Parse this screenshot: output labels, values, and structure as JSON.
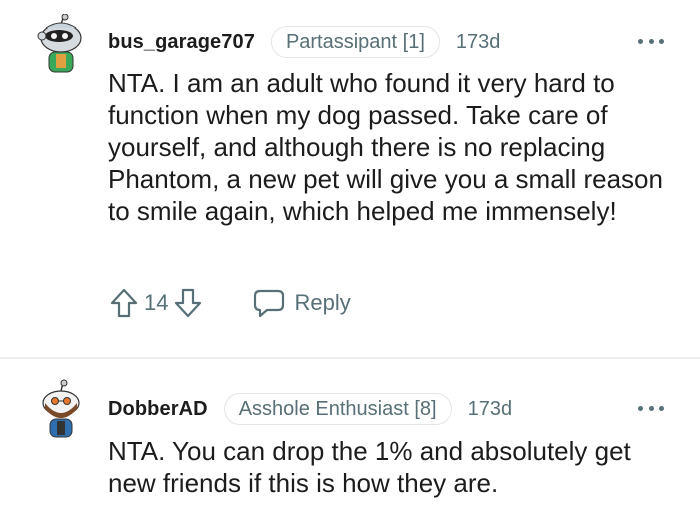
{
  "comments": [
    {
      "username": "bus_garage707",
      "flair": "Partassipant [1]",
      "age": "173d",
      "text": "NTA. I am an adult who found it very hard to function when my dog passed. Take care of yourself, and although there is no replacing Phantom, a new pet will give you a small reason to smile again, which helped me immensely!",
      "votes": "14",
      "reply_label": "Reply",
      "avatar_icon": "snoo-avatar-icon"
    },
    {
      "username": "DobberAD",
      "flair": "Asshole Enthusiast [8]",
      "age": "173d",
      "text": "NTA. You can drop the 1% and absolutely get new friends if this is how they are.",
      "avatar_icon": "snoo-avatar-icon"
    }
  ],
  "colors": {
    "text": "#1c1c1c",
    "meta": "#576f76",
    "border": "#e3e5e8"
  },
  "icons": [
    "upvote-icon",
    "downvote-icon",
    "reply-icon",
    "more-options-icon"
  ]
}
